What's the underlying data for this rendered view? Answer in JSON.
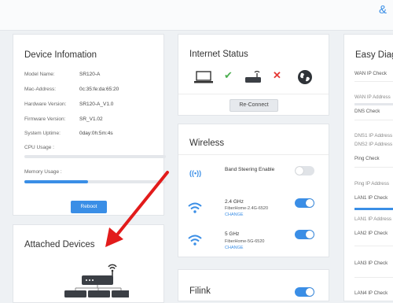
{
  "header": {
    "user_icon": "user-icon"
  },
  "device_info": {
    "title": "Device Infomation",
    "rows": [
      {
        "label": "Model Name:",
        "value": "SR120-A"
      },
      {
        "label": "Mac-Address:",
        "value": "0c:35:fe:da:65:20"
      },
      {
        "label": "Hardware Version:",
        "value": "SR120-A_V1.0"
      },
      {
        "label": "Firmware Version:",
        "value": "SR_V1.02"
      },
      {
        "label": "System Uptime:",
        "value": "0day:0h:5m:4s"
      }
    ],
    "cpu_label": "CPU Usage :",
    "cpu_usage": 0,
    "memory_label": "Memory Usage :",
    "memory_usage": 0.45,
    "reboot_label": "Reboot"
  },
  "attached_devices": {
    "title": "Attached Devices"
  },
  "internet_status": {
    "title": "Internet Status",
    "reconnect_label": "Re-Connect",
    "icons": [
      "laptop-icon",
      "check-icon",
      "router-icon",
      "error-x-icon",
      "globe-icon"
    ],
    "colors": {
      "ok": "#4caf50",
      "error": "#e53935"
    }
  },
  "wireless": {
    "title": "Wireless",
    "band_steering_label": "Band Steering Enable",
    "band_steering_on": false,
    "networks": [
      {
        "band": "2.4 GHz",
        "ssid": "FiberHome-2.4G-6520",
        "change": "CHANGE",
        "on": true
      },
      {
        "band": "5 GHz",
        "ssid": "FiberHome-5G-6520",
        "change": "CHANGE",
        "on": true
      }
    ]
  },
  "filink": {
    "title": "Filink",
    "on": true
  },
  "easy_diagnosis": {
    "title": "Easy Diagr",
    "items": [
      "WAN IP Check",
      "WAN IP Address",
      "DNS Check",
      "DNS1 IP Address",
      "DNS2 IP Address",
      "Ping Check",
      "Ping IP Address",
      "LAN1 IP Check",
      "LAN1 IP Address",
      "LAN2 IP Check",
      "LAN3 IP Check",
      "LAN4 IP Check"
    ]
  },
  "colors": {
    "accent": "#3a8ee6",
    "annotation_arrow": "#e21b1b"
  }
}
